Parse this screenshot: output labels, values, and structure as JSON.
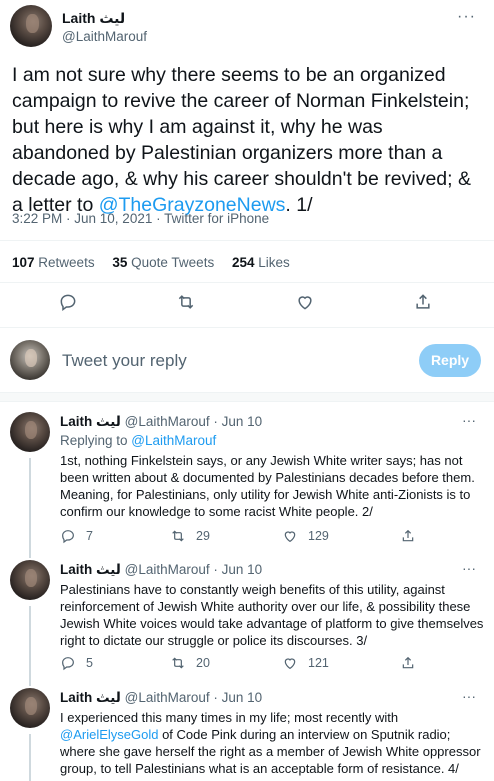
{
  "tweet": {
    "author_name": "Laith ليث",
    "author_handle": "@LaithMarouf",
    "more": "···",
    "text_before_link": "I am not sure why there seems to be an organized campaign to revive the career of Norman Finkelstein; but here is why I am against it, why he was abandoned by Palestinian organizers more than a decade ago, & why his career shouldn't be revived; & a letter to ",
    "link": "@TheGrayzoneNews",
    "text_after_link": ". 1/",
    "meta": "3:22 PM · Jun 10, 2021 · Twitter for iPhone",
    "stats": {
      "retweets_count": "107",
      "retweets_label": "Retweets",
      "quotes_count": "35",
      "quotes_label": "Quote Tweets",
      "likes_count": "254",
      "likes_label": "Likes"
    }
  },
  "composer": {
    "placeholder": "Tweet your reply",
    "button": "Reply"
  },
  "replies": [
    {
      "name": "Laith ليث",
      "handle": "@LaithMarouf",
      "date": " · Jun 10",
      "replying_prefix": "Replying to ",
      "replying_to": "@LaithMarouf",
      "text": "1st, nothing Finkelstein says, or any Jewish White writer says; has not been written about & documented by Palestinians decades before them. Meaning, for Palestinians, only utility for Jewish White anti-Zionists is to confirm our knowledge to some racist White people. 2/",
      "replies": "7",
      "retweets": "29",
      "likes": "129"
    },
    {
      "name": "Laith ليث",
      "handle": "@LaithMarouf",
      "date": " · Jun 10",
      "text": "Palestinians have to constantly weigh benefits of this utility, against reinforcement of Jewish White authority over our life, & possibility these Jewish White voices would take advantage of platform to give themselves right to dictate our struggle or police its discourses. 3/",
      "replies": "5",
      "retweets": "20",
      "likes": "121"
    },
    {
      "name": "Laith ليث",
      "handle": "@LaithMarouf",
      "date": " · Jun 10",
      "text_before_link": "I experienced this many times in my life; most recently with ",
      "link": "@ArielElyseGold",
      "text_after_link": " of Code Pink during an interview on Sputnik radio; where she gave herself the right as a member of Jewish White oppressor group, to tell Palestinians what is an acceptable form of resistance. 4/"
    }
  ],
  "colors": {
    "accent": "#1d9bf0",
    "muted": "#536471",
    "reply_button": "#8ecdf7"
  },
  "icons": [
    "reply-icon",
    "retweet-icon",
    "like-icon",
    "share-icon",
    "more-icon"
  ]
}
